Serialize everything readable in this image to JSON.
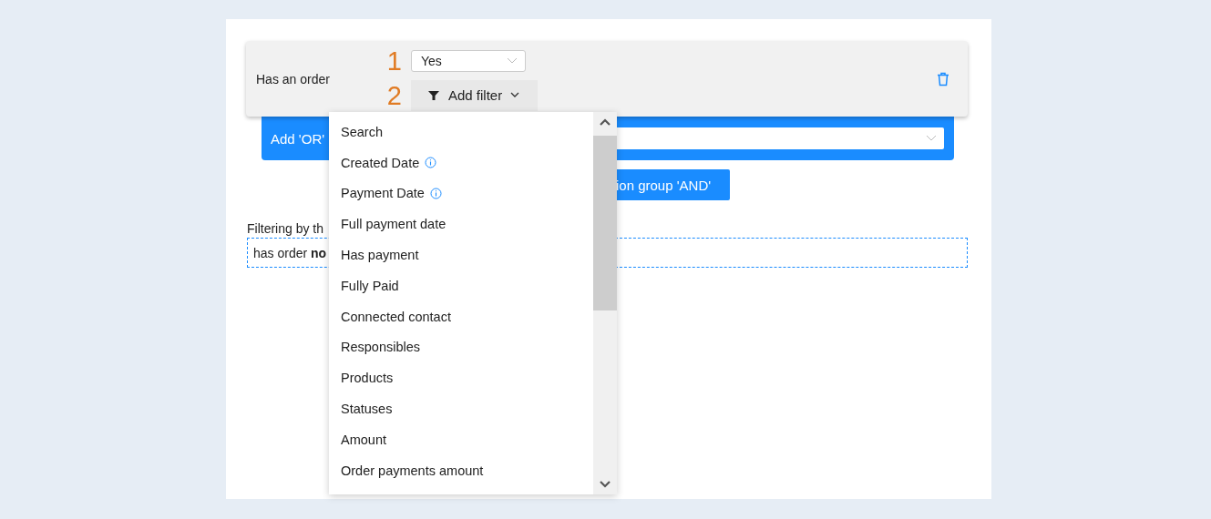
{
  "condition": {
    "label": "Has an order",
    "markers": [
      "1",
      "2"
    ],
    "value_select": {
      "value": "Yes"
    },
    "add_filter_button": {
      "label": "Add filter"
    }
  },
  "or_group": {
    "label": "Add 'OR'"
  },
  "and_group_button": {
    "label": "ion group 'AND'"
  },
  "summary": {
    "heading": "Filtering by th",
    "text": "has order **no**"
  },
  "filter_menu": {
    "items": [
      {
        "label": "Search",
        "info": false
      },
      {
        "label": "Created Date",
        "info": true
      },
      {
        "label": "Payment Date",
        "info": true
      },
      {
        "label": "Full payment date",
        "info": false
      },
      {
        "label": "Has payment",
        "info": false
      },
      {
        "label": "Fully Paid",
        "info": false
      },
      {
        "label": "Connected contact",
        "info": false
      },
      {
        "label": "Responsibles",
        "info": false
      },
      {
        "label": "Products",
        "info": false
      },
      {
        "label": "Statuses",
        "info": false
      },
      {
        "label": "Amount",
        "info": false
      },
      {
        "label": "Order payments amount",
        "info": false
      }
    ]
  }
}
